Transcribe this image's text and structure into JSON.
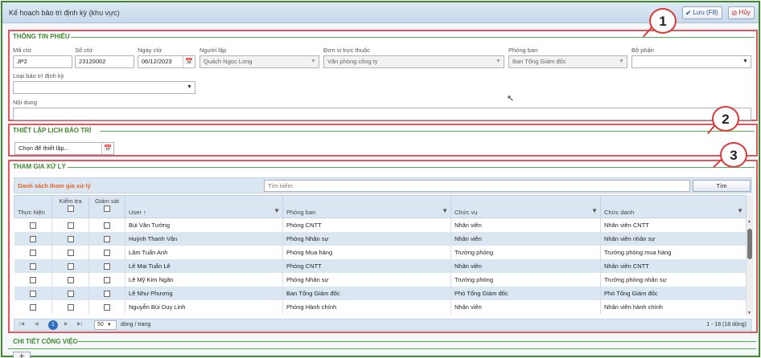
{
  "window": {
    "title": "Kế hoạch bảo trì định kỳ (khu vực)"
  },
  "toolbar": {
    "save_label": "Lưu (F8)",
    "cancel_label": "Hủy"
  },
  "section1": {
    "title": "THÔNG TIN PHIẾU",
    "fields": {
      "ma_ct": {
        "label": "Mã ctừ",
        "value": "JP2"
      },
      "so_ct": {
        "label": "Số ctừ",
        "value": "23120002"
      },
      "ngay_ct": {
        "label": "Ngày ctừ",
        "value": "06/12/2023"
      },
      "nguoi_lap": {
        "label": "Người lập",
        "value": "Quách Ngọc Long"
      },
      "don_vi": {
        "label": "Đơn vị trực thuộc",
        "value": "Văn phòng công ty"
      },
      "phong_ban": {
        "label": "Phòng ban",
        "value": "Ban Tổng Giám đốc"
      },
      "bo_phan": {
        "label": "Bộ phận",
        "value": ""
      },
      "loai_bao_tri": {
        "label": "Loại bảo trì định kỳ",
        "value": ""
      },
      "noi_dung": {
        "label": "Nội dung",
        "value": ""
      }
    }
  },
  "section2": {
    "title": "THIẾT LẬP LỊCH BẢO TRÌ",
    "schedule_value": "Chọn để thiết lập..."
  },
  "section3": {
    "title": "THAM GIA XỬ LÝ",
    "grid_title": "Danh sách tham gia xử lý",
    "search_placeholder": "Tìm kiếm",
    "search_button": "Tìm",
    "columns": {
      "thuc_hien": "Thực hiện",
      "kiem_tra": "Kiểm tra",
      "giam_sat": "Giám sát",
      "user": "User",
      "sort_indicator": "↑",
      "phong_ban": "Phòng ban",
      "chuc_vu": "Chức vụ",
      "chuc_danh": "Chức danh"
    },
    "rows": [
      {
        "user": "Bùi Văn Tưởng",
        "phong_ban": "Phòng CNTT",
        "chuc_vu": "Nhân viên",
        "chuc_danh": "Nhân viên CNTT"
      },
      {
        "user": "Huỳnh Thanh Vân",
        "phong_ban": "Phòng Nhân sự",
        "chuc_vu": "Nhân viên",
        "chuc_danh": "Nhân viên nhân sự"
      },
      {
        "user": "Lâm Tuấn Anh",
        "phong_ban": "Phòng Mua hàng",
        "chuc_vu": "Trưởng phòng",
        "chuc_danh": "Trưởng phòng mua hàng"
      },
      {
        "user": "Lê Mai Tuấn Lê",
        "phong_ban": "Phòng CNTT",
        "chuc_vu": "Nhân viên",
        "chuc_danh": "Nhân viên CNTT"
      },
      {
        "user": "Lê Mỹ Kim Ngân",
        "phong_ban": "Phòng Nhân sự",
        "chuc_vu": "Trưởng phòng",
        "chuc_danh": "Trưởng phòng nhân sự"
      },
      {
        "user": "Lê Như Phương",
        "phong_ban": "Ban Tổng Giám đốc",
        "chuc_vu": "Phó Tổng Giám đốc",
        "chuc_danh": "Phó Tổng Giám đốc"
      },
      {
        "user": "Nguyễn Bùi Duy Linh",
        "phong_ban": "Phòng Hành chính",
        "chuc_vu": "Nhân viên",
        "chuc_danh": "Nhân viên hành chính"
      }
    ],
    "pager": {
      "current_page": "1",
      "page_size": "50",
      "page_size_label": "dòng / trang",
      "info": "1 - 18 (18 dòng)"
    }
  },
  "section4": {
    "title": "CHI TIẾT CÔNG VIỆC",
    "add_label": "+"
  },
  "callouts": [
    "1",
    "2",
    "3"
  ],
  "colors": {
    "frame": "#3d8a2e",
    "callout": "#d93a3a",
    "section_title": "#3d8a2e",
    "header_bg": "#dbe6f3",
    "grid_title": "#e2632a"
  },
  "icons": [
    "check-icon",
    "cancel-icon",
    "calendar-icon",
    "dropdown-arrow-icon",
    "filter-icon",
    "pager-first-icon",
    "pager-prev-icon",
    "pager-next-icon",
    "pager-last-icon",
    "add-icon"
  ]
}
